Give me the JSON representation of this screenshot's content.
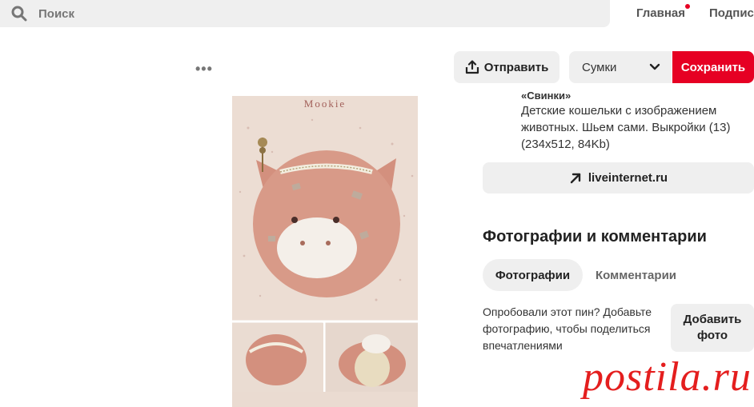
{
  "search": {
    "placeholder": "Поиск"
  },
  "nav": {
    "home": "Главная",
    "subscriptions": "Подпис"
  },
  "toolbar": {
    "more": "•••",
    "send_label": "Отправить",
    "board": "Сумки",
    "save_label": "Сохранить"
  },
  "pin": {
    "image_alt": "Mookie",
    "title_partial": "«Свинки»",
    "description": "Детские кошельки с изображением животных. Шьем сами. Выкройки (13) (234x512, 84Kb)",
    "link": "liveinternet.ru"
  },
  "photos_section": {
    "title": "Фотографии и комментарии",
    "tabs": [
      "Фотографии",
      "Комментарии"
    ],
    "prompt": "Опробовали этот пин? Добавьте фотографию, чтобы поделиться впечатлениями",
    "add_button": "Добавить фото"
  },
  "watermark": {
    "text": "postila.ru"
  },
  "colors": {
    "accent": "#e60023",
    "watermark": "#e41e1e",
    "button_bg": "#efefef"
  }
}
